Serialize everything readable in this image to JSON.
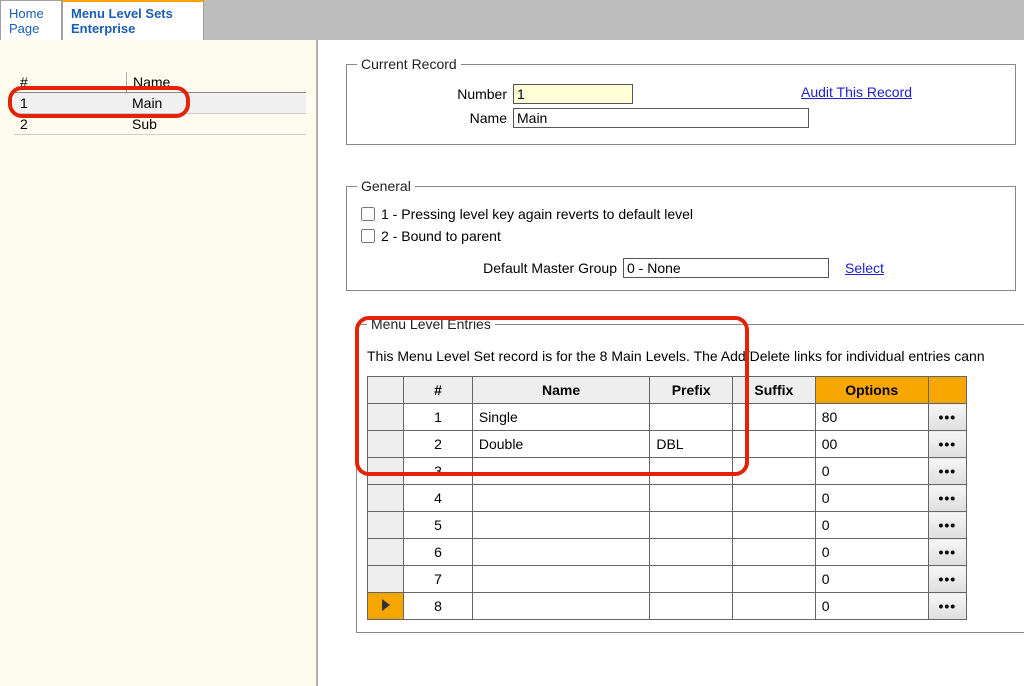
{
  "tabs": {
    "home_line1": "Home",
    "home_line2": "Page",
    "active_line1": "Menu Level Sets",
    "active_line2": "Enterprise"
  },
  "left_grid": {
    "headers": {
      "num": "#",
      "name": "Name"
    },
    "rows": [
      {
        "num": "1",
        "name": "Main"
      },
      {
        "num": "2",
        "name": "Sub"
      }
    ]
  },
  "current_record": {
    "legend": "Current Record",
    "number_label": "Number",
    "number_value": "1",
    "name_label": "Name",
    "name_value": "Main",
    "audit_link": "Audit This Record"
  },
  "general": {
    "legend": "General",
    "opt1": "1 - Pressing level key again reverts to default level",
    "opt2": "2 - Bound to parent",
    "dmg_label": "Default Master Group",
    "dmg_value": "0 - None",
    "select_link": "Select"
  },
  "entries": {
    "legend": "Menu Level Entries",
    "desc": "This Menu Level Set record is for the 8 Main Levels. The Add/Delete links for individual entries cann",
    "headers": {
      "num": "#",
      "name": "Name",
      "prefix": "Prefix",
      "suffix": "Suffix",
      "options": "Options"
    },
    "rows": [
      {
        "num": "1",
        "name": "Single",
        "prefix": "",
        "suffix": "",
        "options": "80",
        "active": false
      },
      {
        "num": "2",
        "name": "Double",
        "prefix": "DBL",
        "suffix": "",
        "options": "00",
        "active": false
      },
      {
        "num": "3",
        "name": "",
        "prefix": "",
        "suffix": "",
        "options": "0",
        "active": false
      },
      {
        "num": "4",
        "name": "",
        "prefix": "",
        "suffix": "",
        "options": "0",
        "active": false
      },
      {
        "num": "5",
        "name": "",
        "prefix": "",
        "suffix": "",
        "options": "0",
        "active": false
      },
      {
        "num": "6",
        "name": "",
        "prefix": "",
        "suffix": "",
        "options": "0",
        "active": false
      },
      {
        "num": "7",
        "name": "",
        "prefix": "",
        "suffix": "",
        "options": "0",
        "active": false
      },
      {
        "num": "8",
        "name": "",
        "prefix": "",
        "suffix": "",
        "options": "0",
        "active": true
      }
    ],
    "more_label": "•••"
  }
}
